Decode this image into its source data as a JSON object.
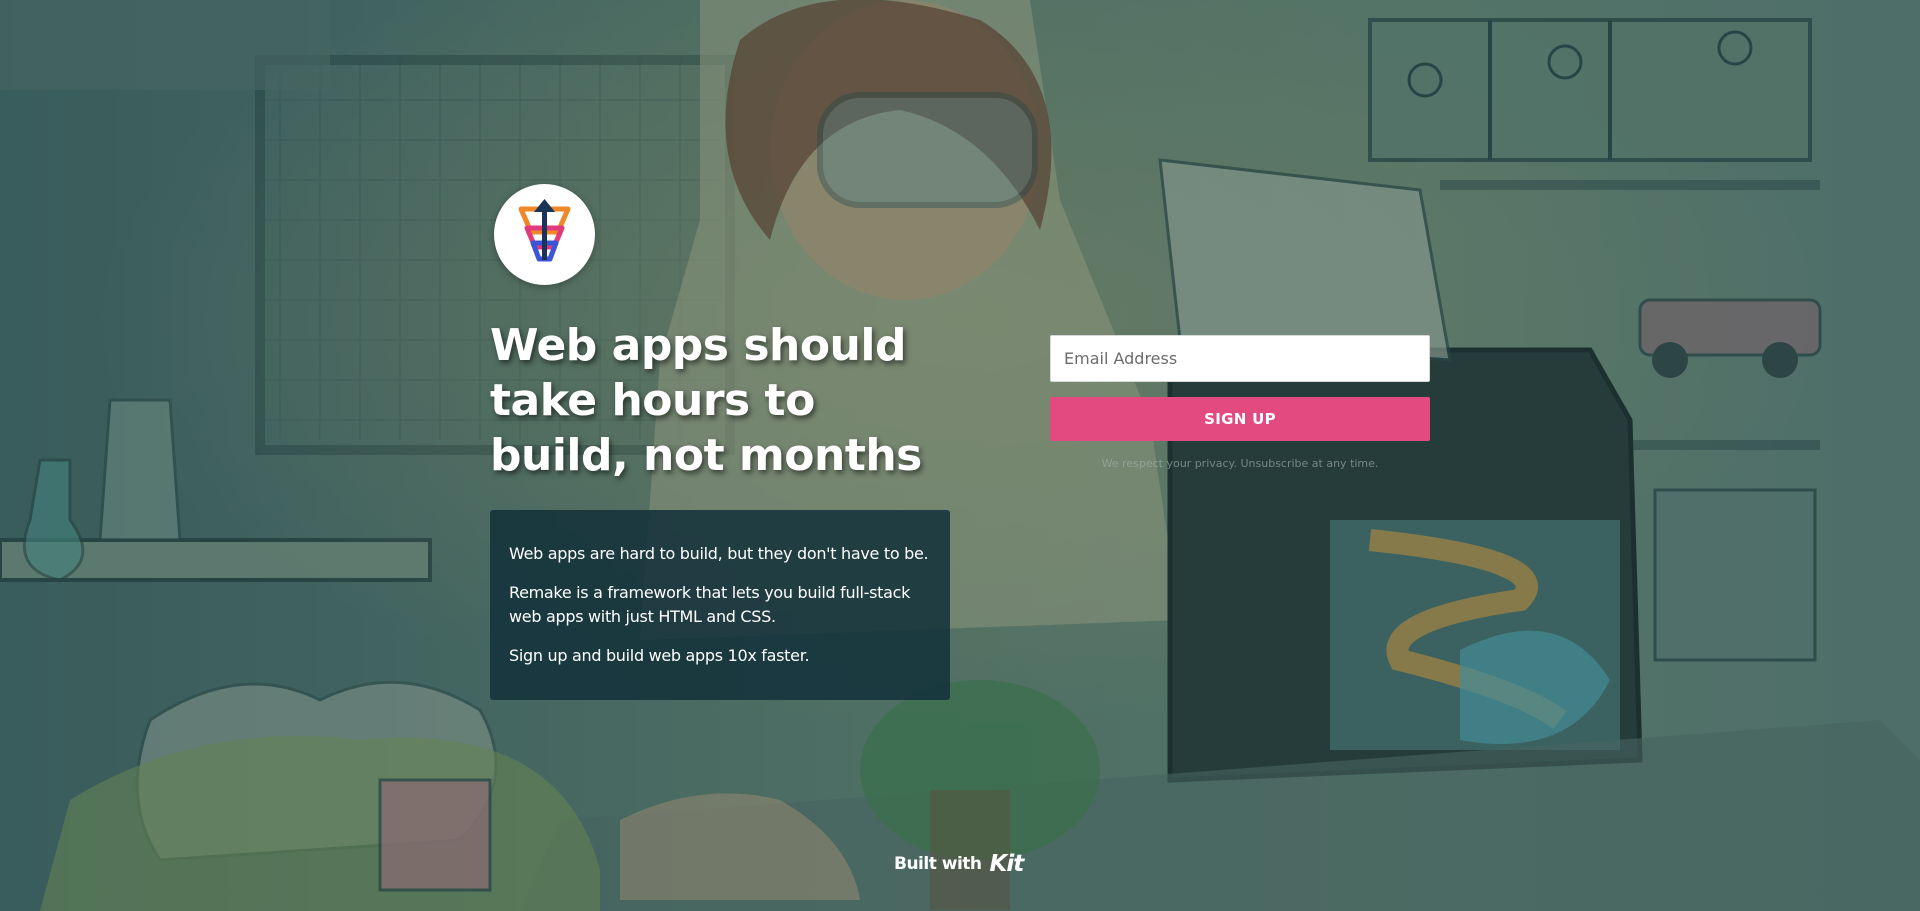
{
  "hero": {
    "headline": "Web apps should take hours to build, not months",
    "description": [
      "Web apps are hard to build, but they don't have to be.",
      "Remake is a framework that lets you build full-stack web apps with just HTML and CSS.",
      "Sign up and build web apps 10x faster."
    ]
  },
  "form": {
    "email_placeholder": "Email Address",
    "email_value": "",
    "signup_label": "SIGN UP",
    "privacy_text": "We respect your privacy. Unsubscribe at any time."
  },
  "footer": {
    "built_with_label": "Built with",
    "brand": "Kit"
  },
  "colors": {
    "accent": "#e34b80",
    "desc_box": "#12303a",
    "background": "#4f6f6a"
  },
  "icons": {
    "logo": "remake-logo-icon",
    "background": "laboratory-illustration"
  }
}
